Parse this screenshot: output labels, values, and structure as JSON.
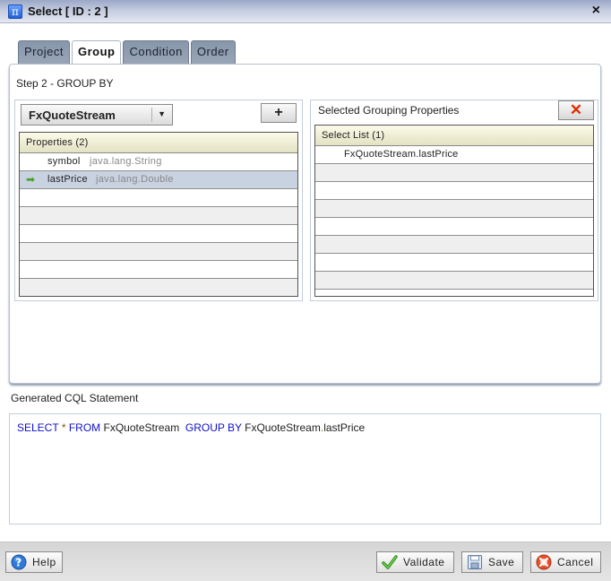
{
  "window": {
    "title": "Select [ ID : 2 ]",
    "icon": "pi-icon",
    "close_label": "×"
  },
  "tabs": [
    {
      "label": "Project",
      "active": false
    },
    {
      "label": "Group",
      "active": true
    },
    {
      "label": "Condition",
      "active": false
    },
    {
      "label": "Order",
      "active": false
    }
  ],
  "step": {
    "label": "Step 2 - GROUP BY"
  },
  "source": {
    "selected_stream": "FxQuoteStream",
    "add_button_label": "+",
    "properties_header": "Properties (2)",
    "properties": [
      {
        "name": "symbol",
        "type": "java.lang.String",
        "selected": false
      },
      {
        "name": "lastPrice",
        "type": "java.lang.Double",
        "selected": true
      }
    ]
  },
  "selected": {
    "title": "Selected Grouping Properties",
    "remove_button_label": "✕",
    "list_header": "Select List (1)",
    "items": [
      "FxQuoteStream.lastPrice"
    ]
  },
  "cql": {
    "label": "Generated CQL Statement",
    "tokens": {
      "select": "SELECT",
      "star": "*",
      "from": "FROM",
      "stream": "FxQuoteStream",
      "group_by": "GROUP BY",
      "group_field_prefix": "FxQuoteStream",
      "group_field_dot": ".",
      "group_field_name": "lastPrice"
    }
  },
  "footer": {
    "help_label": "Help",
    "validate_label": "Validate",
    "save_label": "Save",
    "cancel_label": "Cancel"
  },
  "colors": {
    "keyword": "#1010c8",
    "selected_row": "#c8d2e1",
    "grid_header": "#efeed6",
    "remove_icon": "#e12b00"
  }
}
